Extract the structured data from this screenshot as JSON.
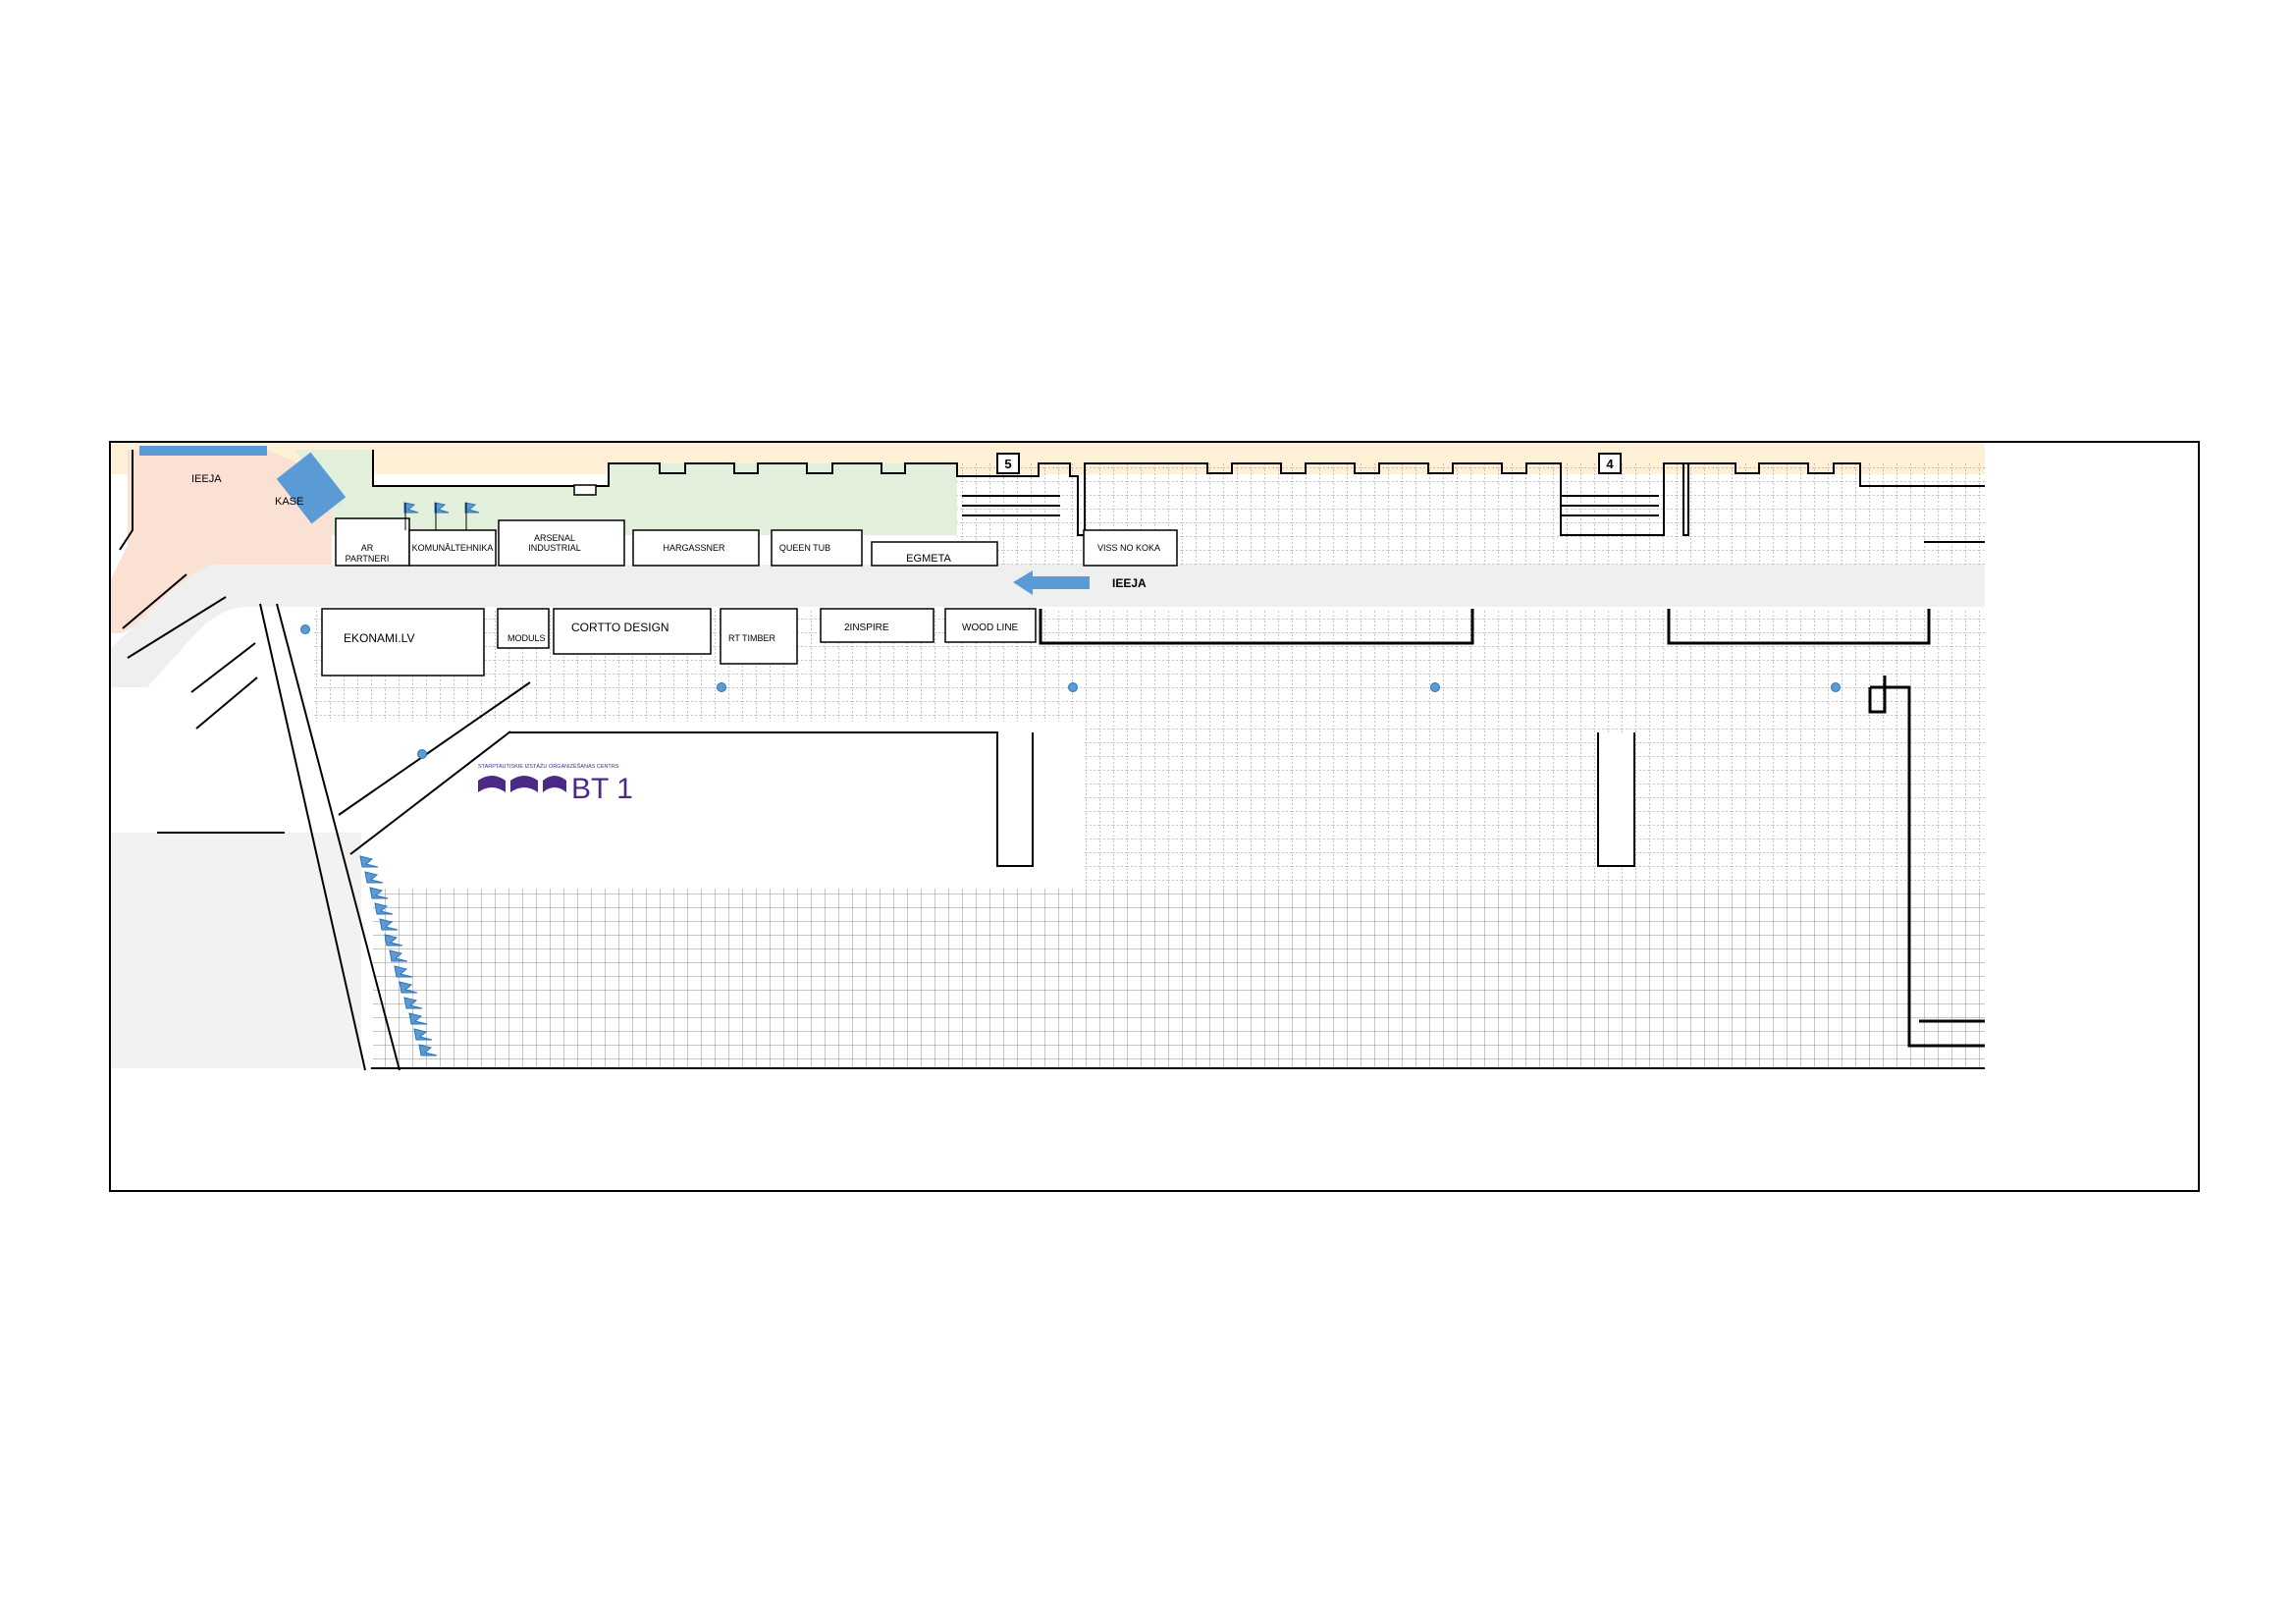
{
  "page": {
    "title": "",
    "colors": {
      "frame": "#000000",
      "top_band": "#fff0d6",
      "entrance_zone": "#fbe0d4",
      "green_zone": "#e2efda",
      "road": "#efefef",
      "grid_line": "#8c8c8c",
      "accent_blue": "#5b9bd5",
      "logo_purple": "#4b2a86"
    }
  },
  "zones": {
    "entrance_label": "IEEJA",
    "cashier_label": "KASE"
  },
  "hall_markers": [
    {
      "id": "5",
      "label": "5"
    },
    {
      "id": "4",
      "label": "4"
    }
  ],
  "road": {
    "arrow_label": "IEEJA",
    "arrow_icon": "left-arrow-icon"
  },
  "booths_top": [
    {
      "id": "ar-partneri",
      "lines": [
        "AR",
        "PARTNERI"
      ]
    },
    {
      "id": "komunaltehnika",
      "lines": [
        "KOMUNĀLTEHNIKA"
      ]
    },
    {
      "id": "arsenal-industrial",
      "lines": [
        "ARSENAL",
        "INDUSTRIAL"
      ]
    },
    {
      "id": "hargassner",
      "lines": [
        "HARGASSNER"
      ]
    },
    {
      "id": "queen-tub",
      "lines": [
        "QUEEN TUB"
      ]
    },
    {
      "id": "egmeta",
      "lines": [
        "EGMETA"
      ]
    },
    {
      "id": "viss-no-koka",
      "lines": [
        "VISS NO KOKA"
      ]
    }
  ],
  "booths_bottom": [
    {
      "id": "ekonami",
      "lines": [
        "EKONAMI.LV"
      ]
    },
    {
      "id": "moduls",
      "lines": [
        "MODULS"
      ]
    },
    {
      "id": "cortto-design",
      "lines": [
        "CORTTO DESIGN"
      ]
    },
    {
      "id": "rt-timber",
      "lines": [
        "RT TIMBER"
      ]
    },
    {
      "id": "2inspire",
      "lines": [
        "2INSPIRE"
      ]
    },
    {
      "id": "wood-line",
      "lines": [
        "WOOD LINE"
      ]
    }
  ],
  "logo": {
    "tagline": "STARPTAUTISKIE IZSTĀŽU ORGANIZĒŠANAS CENTRS",
    "name": "BT 1",
    "icon": "bt1-logo-icon"
  },
  "icons": {
    "flag": "flag-icon",
    "pin": "pin-icon"
  }
}
